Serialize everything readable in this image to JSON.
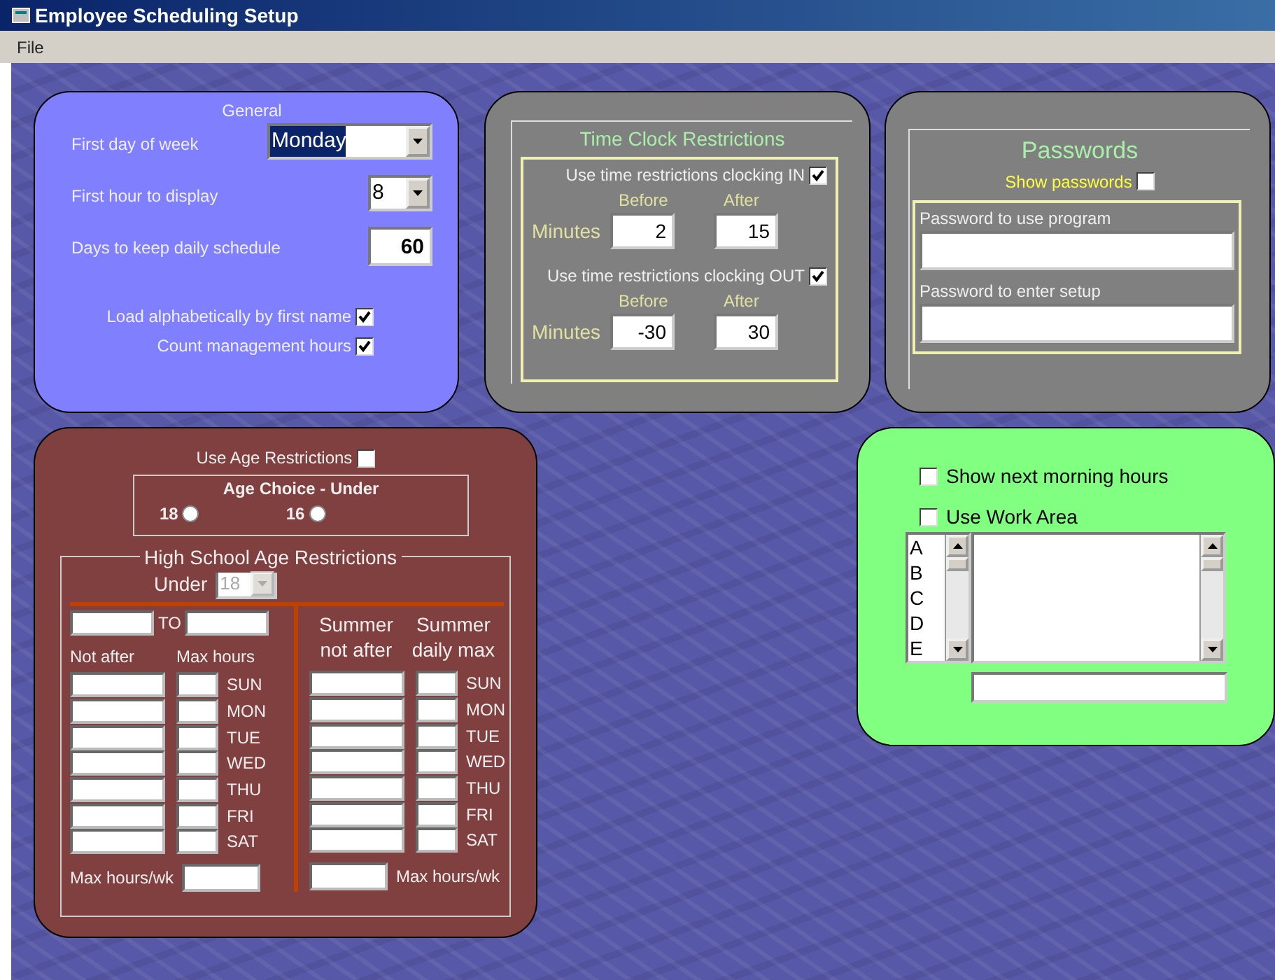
{
  "window": {
    "title": "Employee Scheduling Setup"
  },
  "menu": [
    "File"
  ],
  "general": {
    "title": "General",
    "fields": [
      {
        "kind": "dropdown",
        "label": "First day of week",
        "value": "Monday",
        "selected": true
      },
      {
        "kind": "dropdown",
        "label": "First hour to display",
        "value": "8",
        "selected": false
      },
      {
        "kind": "number",
        "label": "Days to keep daily schedule",
        "value": "60"
      }
    ],
    "checkboxes": [
      {
        "label": "Load alphabetically by first name",
        "checked": true
      },
      {
        "label": "Count management hours",
        "checked": true
      }
    ]
  },
  "time_clock": {
    "title": "Time Clock Restrictions",
    "groups": [
      {
        "label": "Use time restrictions clocking IN",
        "checked": true,
        "before_label": "Before",
        "after_label": "After",
        "minutes_label": "Minutes",
        "before": "2",
        "after": "15"
      },
      {
        "label": "Use time restrictions clocking OUT",
        "checked": true,
        "before_label": "Before",
        "after_label": "After",
        "minutes_label": "Minutes",
        "before": "-30",
        "after": "30"
      }
    ]
  },
  "passwords": {
    "title": "Passwords",
    "show": {
      "label": "Show passwords",
      "checked": false
    },
    "fields": [
      {
        "label": "Password to use program"
      },
      {
        "label": "Password to enter setup"
      }
    ]
  },
  "age": {
    "use": {
      "label": "Use Age Restrictions",
      "checked": false
    },
    "choice": {
      "title": "Age Choice - Under",
      "options": [
        {
          "label": "18",
          "selected": false
        },
        {
          "label": "16",
          "selected": false
        }
      ]
    },
    "high_school": {
      "title": "High School Age Restrictions",
      "under_label": "Under",
      "under_value": "18",
      "under_disabled": true,
      "to_label": "TO",
      "left_headers": [
        "Not after",
        "Max hours"
      ],
      "right_headers": [
        "Summer not after",
        "Summer daily max"
      ],
      "days_left": [
        "SUN",
        "MON",
        "TUE",
        "WED",
        "THU",
        "FRI",
        "SAT"
      ],
      "days_right": [
        "SUN",
        "MON",
        "TUE",
        "WED",
        "THU",
        "FRI",
        "SAT"
      ],
      "max_left": "Max hours/wk",
      "max_right": "Max hours/wk"
    }
  },
  "options": {
    "checkboxes": [
      {
        "label": "Show next morning hours",
        "checked": false
      },
      {
        "label": "Use Work Area",
        "checked": false
      }
    ],
    "list": [
      "A",
      "B",
      "C",
      "D",
      "E"
    ]
  }
}
